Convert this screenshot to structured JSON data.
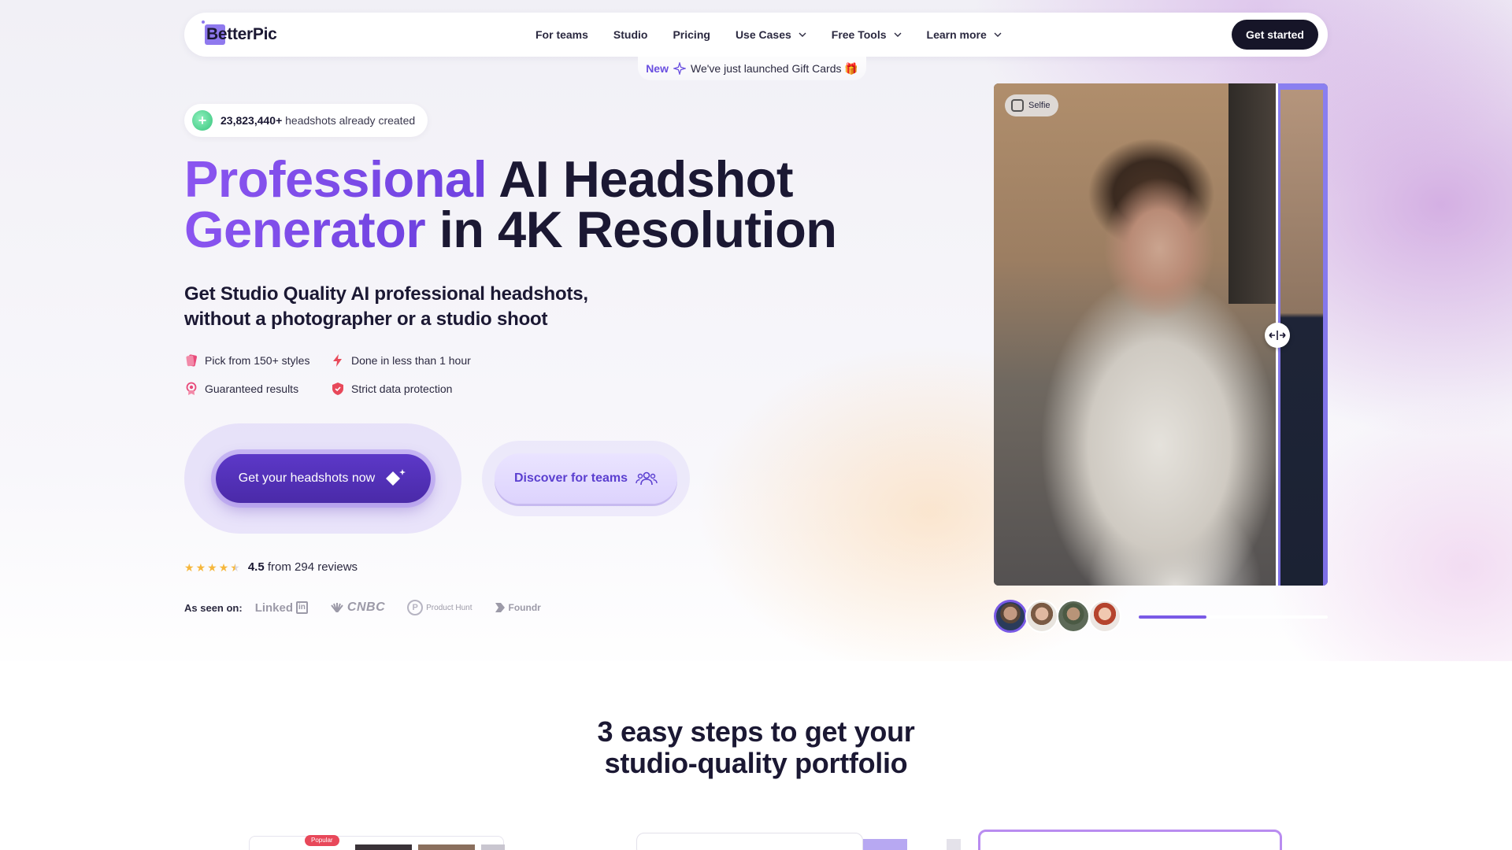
{
  "nav": {
    "logo": "BetterPic",
    "links": [
      "For teams",
      "Studio",
      "Pricing",
      "Use Cases",
      "Free Tools",
      "Learn more"
    ],
    "cta": "Get started"
  },
  "announce": {
    "badge": "New",
    "text": "We've just launched Gift Cards 🎁"
  },
  "hero": {
    "counter_value": "23,823,440+",
    "counter_text": "headshots already created",
    "title_accent_1": "Professional",
    "title_rest_1": " AI Headshot",
    "title_accent_2": "Generator",
    "title_rest_2": " in 4K Resolution",
    "subtitle_1": "Get Studio Quality AI professional headshots,",
    "subtitle_2": "without a photographer or a studio shoot",
    "features": [
      "Pick from 150+ styles",
      "Done in less than 1 hour",
      "Guaranteed results",
      "Strict data protection"
    ],
    "cta_primary": "Get your headshots now",
    "cta_secondary": "Discover for teams",
    "rating_value": "4.5",
    "rating_text": "from 294 reviews",
    "rating_stars": 4.5,
    "seen_label": "As seen on:",
    "press": [
      "Linked",
      "in",
      "CNBC",
      "P",
      "Product Hunt",
      "Foundr"
    ]
  },
  "showcase": {
    "badge": "Selfie",
    "progress": 0.36
  },
  "steps": {
    "title_1": "3 easy steps to get your",
    "title_2": "studio-quality portfolio",
    "popular_badge": "Popular"
  },
  "colors": {
    "accent": "#7a5ae6",
    "primary_button": "#4a2aa8",
    "dark": "#161528",
    "star": "#f6b73c"
  }
}
